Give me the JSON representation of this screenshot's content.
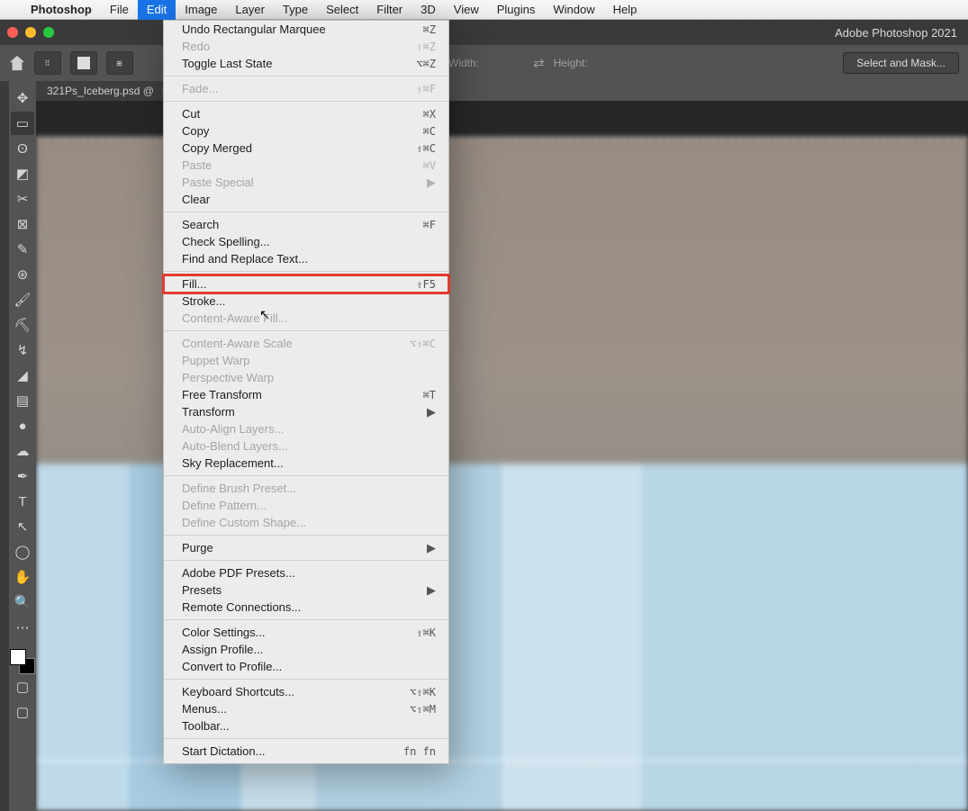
{
  "menubar": {
    "app": "Photoshop",
    "items": [
      "File",
      "Edit",
      "Image",
      "Layer",
      "Type",
      "Select",
      "Filter",
      "3D",
      "View",
      "Plugins",
      "Window",
      "Help"
    ],
    "active": "Edit"
  },
  "window": {
    "title": "Adobe Photoshop 2021"
  },
  "optionsbar": {
    "width_label": "Width:",
    "height_label": "Height:",
    "button": "Select and Mask..."
  },
  "doc_tab": {
    "label": "321Ps_Iceberg.psd @"
  },
  "tools": [
    {
      "name": "move-tool",
      "glyph": "✥"
    },
    {
      "name": "marquee-tool",
      "glyph": "▭",
      "selected": true
    },
    {
      "name": "lasso-tool",
      "glyph": "ʘ"
    },
    {
      "name": "object-select-tool",
      "glyph": "◩"
    },
    {
      "name": "crop-tool",
      "glyph": "✂"
    },
    {
      "name": "frame-tool",
      "glyph": "⊠"
    },
    {
      "name": "eyedropper-tool",
      "glyph": "✎"
    },
    {
      "name": "healing-brush-tool",
      "glyph": "⊛"
    },
    {
      "name": "brush-tool",
      "glyph": "🖌"
    },
    {
      "name": "clone-stamp-tool",
      "glyph": "⛏"
    },
    {
      "name": "history-brush-tool",
      "glyph": "↯"
    },
    {
      "name": "eraser-tool",
      "glyph": "◢"
    },
    {
      "name": "gradient-tool",
      "glyph": "▤"
    },
    {
      "name": "blur-tool",
      "glyph": "●"
    },
    {
      "name": "dodge-tool",
      "glyph": "☁"
    },
    {
      "name": "pen-tool",
      "glyph": "✒"
    },
    {
      "name": "type-tool",
      "glyph": "T"
    },
    {
      "name": "path-select-tool",
      "glyph": "↖"
    },
    {
      "name": "shape-tool",
      "glyph": "◯"
    },
    {
      "name": "hand-tool",
      "glyph": "✋"
    },
    {
      "name": "zoom-tool",
      "glyph": "🔍"
    },
    {
      "name": "edit-toolbar",
      "glyph": "⋯"
    }
  ],
  "edit_menu": [
    [
      {
        "label": "Undo Rectangular Marquee",
        "shortcut": "⌘Z"
      },
      {
        "label": "Redo",
        "shortcut": "⇧⌘Z",
        "disabled": true
      },
      {
        "label": "Toggle Last State",
        "shortcut": "⌥⌘Z"
      }
    ],
    [
      {
        "label": "Fade...",
        "shortcut": "⇧⌘F",
        "disabled": true
      }
    ],
    [
      {
        "label": "Cut",
        "shortcut": "⌘X"
      },
      {
        "label": "Copy",
        "shortcut": "⌘C"
      },
      {
        "label": "Copy Merged",
        "shortcut": "⇧⌘C"
      },
      {
        "label": "Paste",
        "shortcut": "⌘V",
        "disabled": true
      },
      {
        "label": "Paste Special",
        "submenu": true,
        "disabled": true
      },
      {
        "label": "Clear"
      }
    ],
    [
      {
        "label": "Search",
        "shortcut": "⌘F"
      },
      {
        "label": "Check Spelling..."
      },
      {
        "label": "Find and Replace Text..."
      }
    ],
    [
      {
        "label": "Fill...",
        "shortcut": "⇧F5",
        "highlight": true
      },
      {
        "label": "Stroke..."
      },
      {
        "label": "Content-Aware Fill...",
        "disabled": true
      }
    ],
    [
      {
        "label": "Content-Aware Scale",
        "shortcut": "⌥⇧⌘C",
        "disabled": true
      },
      {
        "label": "Puppet Warp",
        "disabled": true
      },
      {
        "label": "Perspective Warp",
        "disabled": true
      },
      {
        "label": "Free Transform",
        "shortcut": "⌘T"
      },
      {
        "label": "Transform",
        "submenu": true
      },
      {
        "label": "Auto-Align Layers...",
        "disabled": true
      },
      {
        "label": "Auto-Blend Layers...",
        "disabled": true
      },
      {
        "label": "Sky Replacement..."
      }
    ],
    [
      {
        "label": "Define Brush Preset...",
        "disabled": true
      },
      {
        "label": "Define Pattern...",
        "disabled": true
      },
      {
        "label": "Define Custom Shape...",
        "disabled": true
      }
    ],
    [
      {
        "label": "Purge",
        "submenu": true
      }
    ],
    [
      {
        "label": "Adobe PDF Presets..."
      },
      {
        "label": "Presets",
        "submenu": true
      },
      {
        "label": "Remote Connections..."
      }
    ],
    [
      {
        "label": "Color Settings...",
        "shortcut": "⇧⌘K"
      },
      {
        "label": "Assign Profile..."
      },
      {
        "label": "Convert to Profile..."
      }
    ],
    [
      {
        "label": "Keyboard Shortcuts...",
        "shortcut": "⌥⇧⌘K"
      },
      {
        "label": "Menus...",
        "shortcut": "⌥⇧⌘M"
      },
      {
        "label": "Toolbar..."
      }
    ],
    [
      {
        "label": "Start Dictation...",
        "shortcut": "fn fn"
      }
    ]
  ]
}
